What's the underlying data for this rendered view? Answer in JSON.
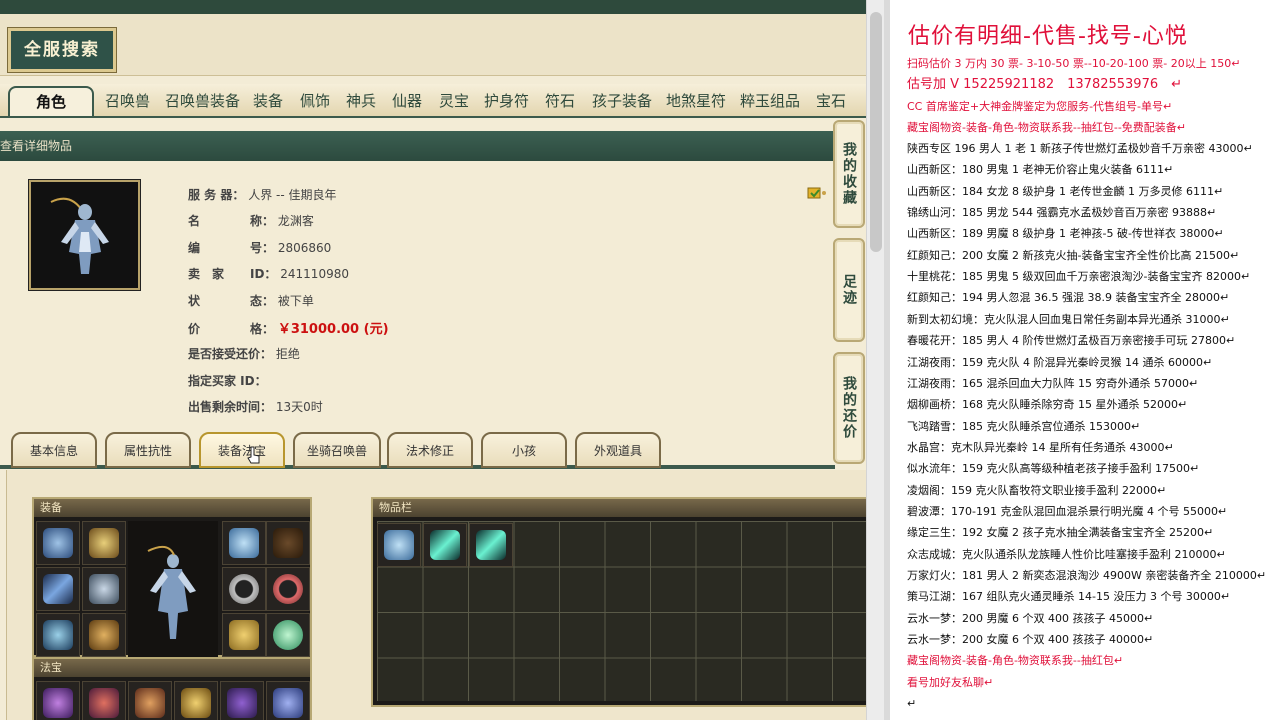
{
  "search_button": "全服搜索",
  "category_tabs": [
    "角色",
    "召唤兽",
    "召唤兽装备",
    "装备",
    "佩饰",
    "神兵",
    "仙器",
    "灵宝",
    "护身符",
    "符石",
    "孩子装备",
    "地煞星符",
    "粹玉组品",
    "宝石"
  ],
  "detail_header": "查看详细物品",
  "info": {
    "server_label": "服 务 器：",
    "server": "人界 -- 佳期良年",
    "name_label1": "名",
    "name_label2": "称：",
    "name": "龙渊客",
    "id_label1": "编",
    "id_label2": "号：",
    "item_id": "2806860",
    "seller_label1": "卖　家",
    "seller_label2": "ID：",
    "seller_id": "241110980",
    "status_label1": "状",
    "status_label2": "态：",
    "status": "被下单",
    "price_label1": "价",
    "price_label2": "格：",
    "price": "￥31000.00 (元)",
    "bargain_label": "是否接受还价：",
    "bargain": "拒绝",
    "buyer_label": "指定买家 ID：",
    "buyer": "",
    "remaining_label": "出售剩余时间：",
    "remaining": "13天0时"
  },
  "side_buttons": [
    "我的收藏",
    "足迹",
    "我的还价"
  ],
  "sub_tabs": [
    "基本信息",
    "属性抗性",
    "装备法宝",
    "坐骑召唤兽",
    "法术修正",
    "小孩",
    "外观道具"
  ],
  "active_sub_tab": 2,
  "equip_panel_title": "装备",
  "fabao_panel_title": "法宝",
  "inventory_panel_title": "物品栏",
  "colors": {
    "dark_green": "#2e4a3c",
    "price_red": "#cc1010",
    "doc_red": "#e0103a"
  },
  "doc": {
    "title": "估价有明细-代售-找号-心悦",
    "lines": [
      {
        "style": "red",
        "text": "扫码估价 3 万内 30 票- 3-10-50 票--10-20-100 票- 20以上 150↵"
      },
      {
        "style": "redbig",
        "text": "估号加 V 15225921182　13782553976　↵"
      },
      {
        "style": "red",
        "text": "CC 首席鉴定+大神金牌鉴定为您服务-代售组号-单号↵"
      },
      {
        "style": "red",
        "text": "藏宝阁物资-装备-角色-物资联系我--抽红包--免费配装备↵"
      },
      {
        "style": "black",
        "text": "陕西专区 196 男人 1 老 1 新孩子传世燃灯孟极妙音千万亲密 43000↵"
      },
      {
        "style": "black",
        "text": "山西新区：180 男鬼 1 老神无价容止鬼火装备 6111↵"
      },
      {
        "style": "black",
        "text": "山西新区：184 女龙 8 级护身 1 老传世金麟 1 万多灵修 6111↵"
      },
      {
        "style": "black",
        "text": "锦绣山河：185 男龙 544 强霸克水孟极妙音百万亲密 93888↵"
      },
      {
        "style": "black",
        "text": "山西新区：189 男魔 8 级护身 1 老神孩-5 破-传世祥衣 38000↵"
      },
      {
        "style": "black",
        "text": "红颜知己：200 女魔 2 新孩克火抽-装备宝宝齐全性价比高 21500↵"
      },
      {
        "style": "black",
        "text": "十里桃花：185 男鬼 5 级双回血千万亲密浪淘沙-装备宝宝齐 82000↵"
      },
      {
        "style": "black",
        "text": "红颜知己：194 男人忽混 36.5 强混 38.9 装备宝宝齐全 28000↵"
      },
      {
        "style": "black",
        "text": "新到太初幻境：克火队混人回血鬼日常任务副本异光通杀 31000↵"
      },
      {
        "style": "black",
        "text": "春暖花开：185 男人 4 阶传世燃灯孟极百万亲密接手可玩 27800↵"
      },
      {
        "style": "black",
        "text": "江湖夜雨：159 克火队 4 阶混异光秦岭灵猴 14 通杀 60000↵"
      },
      {
        "style": "black",
        "text": "江湖夜雨：165 混杀回血大力队阵 15 穷奇外通杀 57000↵"
      },
      {
        "style": "black",
        "text": "烟柳画桥：168 克火队睡杀除穷奇 15 星外通杀 52000↵"
      },
      {
        "style": "black",
        "text": "飞鸿踏雪：185 克火队睡杀宫位通杀 153000↵"
      },
      {
        "style": "black",
        "text": "水晶宫：克木队异光秦岭 14 星所有任务通杀 43000↵"
      },
      {
        "style": "black",
        "text": "似水流年：159 克火队高等级种植老孩子接手盈利 17500↵"
      },
      {
        "style": "black",
        "text": "凌烟阁：159 克火队畜牧符文职业接手盈利 22000↵"
      },
      {
        "style": "black",
        "text": "碧波潭：170-191 克金队混回血混杀景行明光魔 4 个号 55000↵"
      },
      {
        "style": "black",
        "text": "缘定三生：192 女魔 2 孩子克水抽全满装备宝宝齐全 25200↵"
      },
      {
        "style": "black",
        "text": "众志成城：克火队通杀队龙族睡人性价比哇塞接手盈利 210000↵"
      },
      {
        "style": "black",
        "text": "万家灯火：181 男人 2 新奕态混浪淘沙 4900W 亲密装备齐全 210000↵"
      },
      {
        "style": "black",
        "text": "策马江湖：167 组队克火通灵睡杀 14-15 没压力 3 个号 30000↵"
      },
      {
        "style": "black",
        "text": "云水一梦：200 男魔 6 个双 400 孩孩子 45000↵"
      },
      {
        "style": "black",
        "text": "云水一梦：200 女魔 6 个双 400 孩孩子 40000↵"
      },
      {
        "style": "red",
        "text": "藏宝阁物资-装备-角色-物资联系我--抽红包↵"
      },
      {
        "style": "red",
        "text": "看号加好友私聊↵"
      },
      {
        "style": "black",
        "text": "↵"
      }
    ]
  }
}
